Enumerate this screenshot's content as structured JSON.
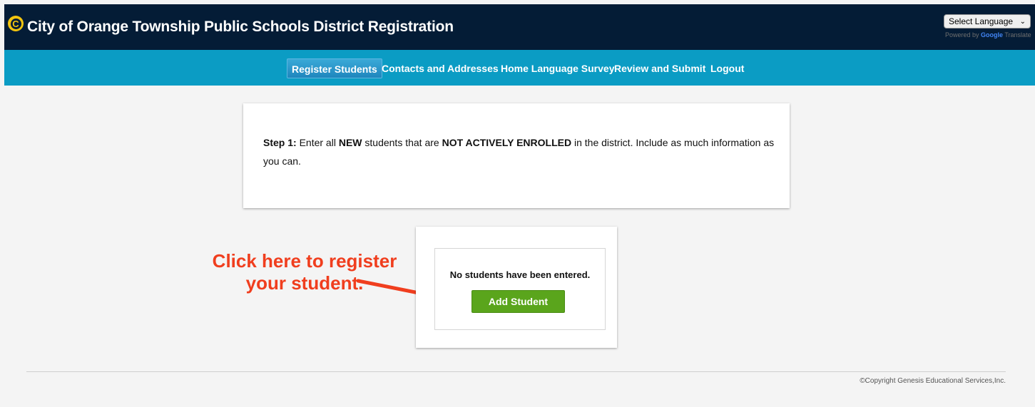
{
  "header": {
    "title": "City of Orange Township Public Schools District Registration",
    "logo_letter": "C",
    "language_select": {
      "selected": "Select Language",
      "powered_by": "Powered by",
      "google": "Google",
      "translate": "Translate"
    }
  },
  "nav": {
    "items": [
      {
        "label": "Register Students",
        "active": true
      },
      {
        "label": "Contacts and Addresses",
        "active": false
      },
      {
        "label": "Home Language Survey",
        "active": false
      },
      {
        "label": "Review and Submit",
        "active": false
      },
      {
        "label": "Logout",
        "active": false
      }
    ]
  },
  "step": {
    "prefix": "Step 1:",
    "text1": " Enter all ",
    "bold1": "NEW",
    "text2": " students that are ",
    "bold2": "NOT ACTIVELY ENROLLED",
    "text3": " in the district. Include as much information as you can."
  },
  "students": {
    "empty_message": "No students have been entered.",
    "add_button_label": "Add Student"
  },
  "annotation": {
    "line1": "Click here to register",
    "line2": "your student."
  },
  "footer": {
    "copyright": "©Copyright Genesis Educational Services,Inc."
  },
  "colors": {
    "header_bg": "#041c36",
    "nav_bg": "#0b9cc4",
    "add_button": "#5aa51c",
    "annotation": "#f03e1e"
  }
}
